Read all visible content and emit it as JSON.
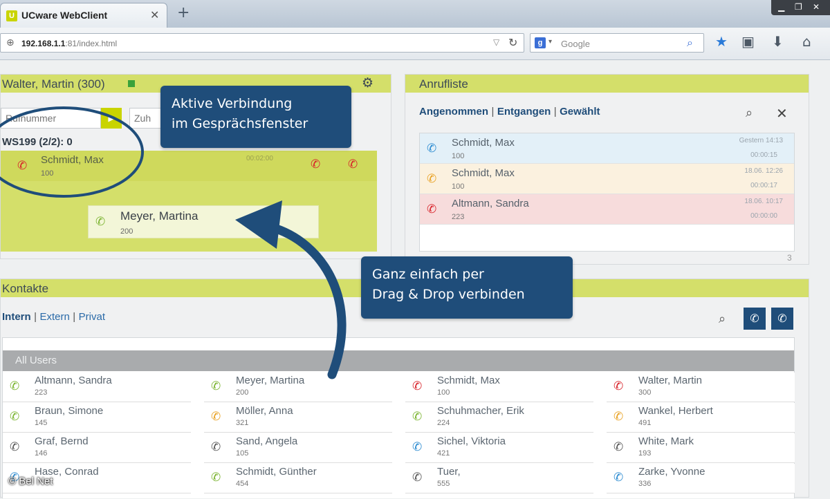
{
  "browser": {
    "tab_title": "UCware WebClient",
    "tab_close": "✕",
    "new_tab": "+",
    "url_host": "192.168.1.1",
    "url_rest": ":81/index.html",
    "search_engine_badge": "g",
    "search_placeholder": "Google"
  },
  "user_panel": {
    "title": "Walter, Martin (300)",
    "search_placeholder": "Rufnummer",
    "transfer_placeholder": "Zuh",
    "go_label": "▶",
    "line_label": "WS199 (2/2): 0",
    "active_call": {
      "name": "Schmidt, Max",
      "number": "100",
      "duration": "00:02:00"
    },
    "held_call": {
      "name": "Meyer, Martina",
      "number": "200"
    }
  },
  "call_log": {
    "title": "Anrufliste",
    "filters": [
      "Angenommen",
      "Entgangen",
      "Gewählt"
    ],
    "separator": "|",
    "rows": [
      {
        "name": "Schmidt, Max",
        "number": "100",
        "time": "Gestern 14:13",
        "duration": "00:00:15",
        "state": "received",
        "bg": "#e3f0f8"
      },
      {
        "name": "Schmidt, Max",
        "number": "100",
        "time": "18.06. 12:26",
        "duration": "00:00:17",
        "state": "outgoing",
        "bg": "#fbf1df"
      },
      {
        "name": "Altmann, Sandra",
        "number": "223",
        "time": "18.06. 10:17",
        "duration": "00:00:00",
        "state": "missed",
        "bg": "#f7dcdc"
      }
    ],
    "count": "3"
  },
  "contacts": {
    "title": "Kontakte",
    "filters": [
      "Intern",
      "Extern",
      "Privat"
    ],
    "separator": "|",
    "group_label": "All Users",
    "columns": [
      [
        {
          "name": "Altmann, Sandra",
          "number": "223",
          "status": "green"
        },
        {
          "name": "Braun, Simone",
          "number": "145",
          "status": "green"
        },
        {
          "name": "Graf, Bernd",
          "number": "146",
          "status": "gray"
        },
        {
          "name": "Hase, Conrad",
          "number": "",
          "status": "blue"
        }
      ],
      [
        {
          "name": "Meyer, Martina",
          "number": "200",
          "status": "green"
        },
        {
          "name": "Möller, Anna",
          "number": "321",
          "status": "orange"
        },
        {
          "name": "Sand, Angela",
          "number": "105",
          "status": "gray"
        },
        {
          "name": "Schmidt, Günther",
          "number": "454",
          "status": "green"
        }
      ],
      [
        {
          "name": "Schmidt, Max",
          "number": "100",
          "status": "red"
        },
        {
          "name": "Schuhmacher, Erik",
          "number": "224",
          "status": "green"
        },
        {
          "name": "Sichel, Viktoria",
          "number": "421",
          "status": "blue"
        },
        {
          "name": "Tuer,",
          "number": "555",
          "status": "gray"
        }
      ],
      [
        {
          "name": "Walter, Martin",
          "number": "300",
          "status": "red"
        },
        {
          "name": "Wankel, Herbert",
          "number": "491",
          "status": "orange"
        },
        {
          "name": "White, Mark",
          "number": "193",
          "status": "gray"
        },
        {
          "name": "Zarke, Yvonne",
          "number": "336",
          "status": "blue"
        }
      ]
    ]
  },
  "callouts": {
    "top_line1": "Aktive Verbindung",
    "top_line2": "im Gesprächsfenster",
    "bottom_line1": "Ganz einfach per",
    "bottom_line2": "Drag & Drop verbinden"
  },
  "watermark": "© Bel Net",
  "colors": {
    "accent_green": "#d4df6a",
    "brand_blue": "#1f4d7a",
    "status_red": "#d8232a",
    "status_green": "#7ab32e"
  }
}
